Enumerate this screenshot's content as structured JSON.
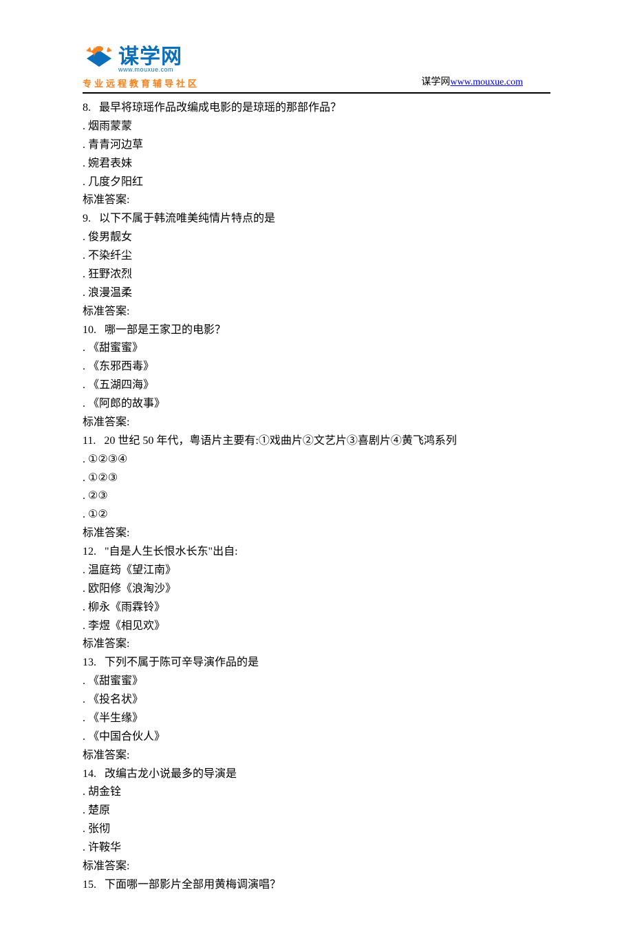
{
  "header": {
    "logo_text": "谋学网",
    "logo_url_small": "www.mouxue.com",
    "logo_subtitle": "专业远程教育辅导社区",
    "site_label": "谋学网",
    "site_url_text": "www.mouxue.com"
  },
  "questions": [
    {
      "num": "8.   ",
      "text": "最早将琼瑶作品改编成电影的是琼瑶的那部作品？",
      "options": [
        "烟雨蒙蒙",
        "青青河边草",
        "婉君表妹",
        "几度夕阳红"
      ],
      "answer_label": "标准答案:"
    },
    {
      "num": "9.   ",
      "text": "以下不属于韩流唯美纯情片特点的是",
      "options": [
        "俊男靓女",
        "不染纤尘",
        "狂野浓烈",
        "浪漫温柔"
      ],
      "answer_label": "标准答案:"
    },
    {
      "num": "10.   ",
      "text": "哪一部是王家卫的电影？",
      "options": [
        "《甜蜜蜜》",
        "《东邪西毒》",
        "《五湖四海》",
        "《阿郎的故事》"
      ],
      "answer_label": "标准答案:"
    },
    {
      "num": "11.   ",
      "text": "20 世纪 50 年代，粤语片主要有:①戏曲片②文艺片③喜剧片④黄飞鸿系列",
      "options": [
        "①②③④",
        "①②③",
        "②③",
        "①②"
      ],
      "answer_label": "标准答案:"
    },
    {
      "num": "12.   ",
      "text": "\"自是人生长恨水长东\"出自:",
      "options": [
        "温庭筠《望江南》",
        "欧阳修《浪淘沙》",
        "柳永《雨霖铃》",
        "李煜《相见欢》"
      ],
      "answer_label": "标准答案:"
    },
    {
      "num": "13.   ",
      "text": "下列不属于陈可辛导演作品的是",
      "options": [
        "《甜蜜蜜》",
        "《投名状》",
        "《半生缘》",
        "《中国合伙人》"
      ],
      "answer_label": "标准答案:"
    },
    {
      "num": "14.   ",
      "text": "改编古龙小说最多的导演是",
      "options": [
        "胡金铨",
        "楚原",
        "张彻",
        "许鞍华"
      ],
      "answer_label": "标准答案:"
    },
    {
      "num": "15.   ",
      "text": "下面哪一部影片全部用黄梅调演唱？",
      "options": [],
      "answer_label": ""
    }
  ]
}
